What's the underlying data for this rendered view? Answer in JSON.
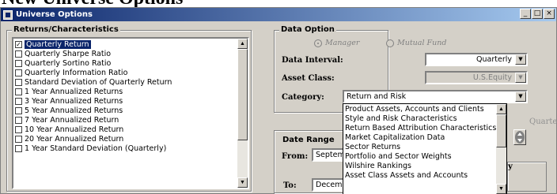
{
  "page": {
    "heading": "New Universe Options"
  },
  "window": {
    "title": "Universe Options",
    "buttons": {
      "minimize": "_",
      "maximize": "□",
      "close": "×"
    }
  },
  "returns": {
    "group_label": "Returns/Characteristics",
    "items": [
      {
        "label": "Quarterly Return",
        "checked": true,
        "selected": true
      },
      {
        "label": "Quarterly Sharpe Ratio",
        "checked": false
      },
      {
        "label": "Quarterly Sortino Ratio",
        "checked": false
      },
      {
        "label": "Quarterly Information Ratio",
        "checked": false
      },
      {
        "label": "Standard Deviation of Quarterly Return",
        "checked": false
      },
      {
        "label": "1 Year Annualized Returns",
        "checked": false
      },
      {
        "label": "3 Year Annualized Returns",
        "checked": false
      },
      {
        "label": "5 Year Annualized Returns",
        "checked": false
      },
      {
        "label": "7 Year Annualized Return",
        "checked": false
      },
      {
        "label": "10 Year Annualized Return",
        "checked": false
      },
      {
        "label": "20 Year Annualized Return",
        "checked": false
      },
      {
        "label": "1 Year Standard Deviation (Quarterly)",
        "checked": false
      }
    ]
  },
  "data_option": {
    "group_label": "Data Option",
    "radio_manager": "Manager",
    "radio_mutual_fund": "Mutual Fund",
    "interval_label": "Data Interval:",
    "interval_value": "Quarterly",
    "asset_class_label": "Asset Class:",
    "asset_class_value": "U.S.Equity",
    "category_label": "Category:",
    "category_value": "Return and Risk",
    "category_options": [
      "Product Assets, Accounts and Clients",
      "Style and Risk Characteristics",
      "Return Based Attribution Characteristics",
      "Market Capitalization Data",
      "Sector Returns",
      "Portfolio and Sector Weights",
      "Wilshire Rankings",
      "Asset Class Assets and Accounts"
    ]
  },
  "date_range": {
    "group_label": "Date Range",
    "from_label": "From:",
    "from_value": "September",
    "to_label": "To:",
    "to_value": "December",
    "quarters_label": "Quarters",
    "partial_label": "y"
  }
}
